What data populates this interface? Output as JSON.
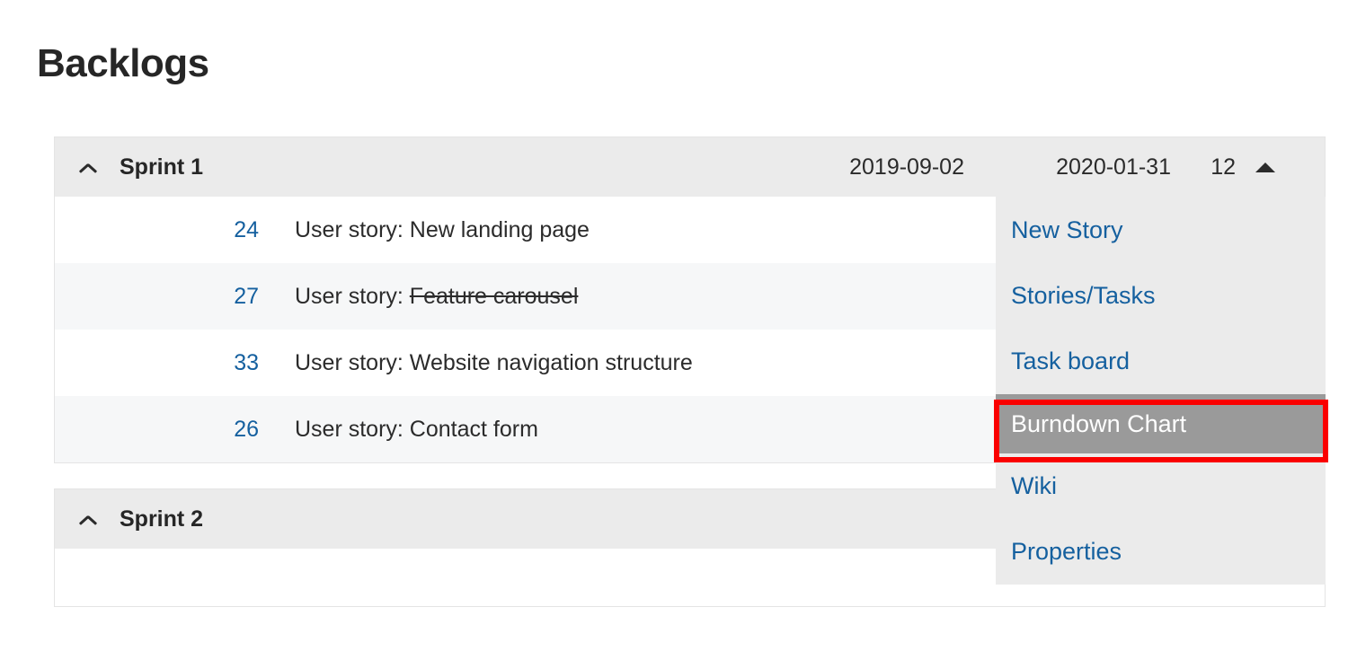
{
  "page": {
    "title": "Backlogs"
  },
  "sprints": [
    {
      "name": "Sprint 1",
      "start_date": "2019-09-02",
      "end_date": "2020-01-31",
      "count": "12",
      "collapse_icon": "chevron-up-icon",
      "caret_icon": "caret-up-icon",
      "stories": [
        {
          "id": "24",
          "prefix": "User story: ",
          "title": "New landing page",
          "struck": false
        },
        {
          "id": "27",
          "prefix": "User story: ",
          "title": "Feature carousel",
          "struck": true
        },
        {
          "id": "33",
          "prefix": "User story: ",
          "title": "Website navigation structure",
          "struck": false
        },
        {
          "id": "26",
          "prefix": "User story: ",
          "title": "Contact form",
          "struck": false
        }
      ]
    },
    {
      "name": "Sprint 2",
      "start_date": "",
      "end_date": "",
      "count": "",
      "collapse_icon": "chevron-up-icon",
      "stories": []
    }
  ],
  "dropdown": {
    "items": [
      {
        "label": "New Story",
        "highlighted": false
      },
      {
        "label": "Stories/Tasks",
        "highlighted": false
      },
      {
        "label": "Task board",
        "highlighted": false
      },
      {
        "label": "Burndown Chart",
        "highlighted": true
      },
      {
        "label": "Wiki",
        "highlighted": false
      },
      {
        "label": "Properties",
        "highlighted": false
      }
    ]
  },
  "annotation": {
    "target": "Burndown Chart",
    "color": "#fa0000"
  },
  "colors": {
    "link": "#15609f",
    "header_bg": "#ebebeb",
    "alt_row_bg": "#f6f7f8",
    "highlight_bg": "#9a9a9a",
    "annotation": "#fa0000",
    "text": "#2b2b2b"
  }
}
